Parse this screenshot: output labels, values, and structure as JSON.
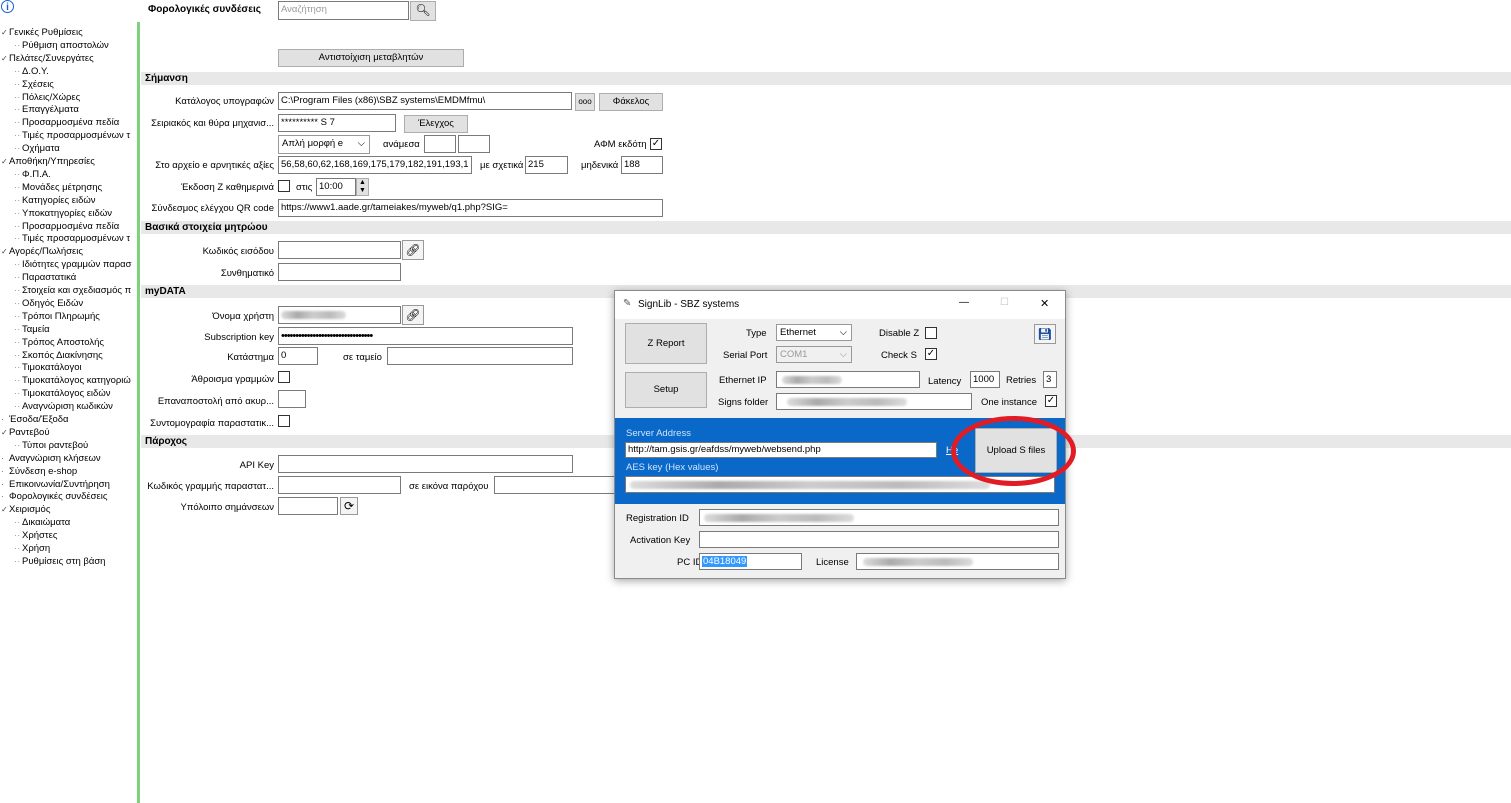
{
  "tree": {
    "items": [
      {
        "label": "Γενικές Ρυθμίσεις",
        "level": 0,
        "expanded": true
      },
      {
        "label": "Ρύθμιση αποστολών",
        "level": 1
      },
      {
        "label": "Πελάτες/Συνεργάτες",
        "level": 0,
        "expanded": true
      },
      {
        "label": "Δ.Ο.Υ.",
        "level": 1
      },
      {
        "label": "Σχέσεις",
        "level": 1
      },
      {
        "label": "Πόλεις/Χώρες",
        "level": 1
      },
      {
        "label": "Επαγγέλματα",
        "level": 1
      },
      {
        "label": "Προσαρμοσμένα πεδία",
        "level": 1
      },
      {
        "label": "Τιμές προσαρμοσμένων τ",
        "level": 1
      },
      {
        "label": "Οχήματα",
        "level": 1
      },
      {
        "label": "Αποθήκη/Υπηρεσίες",
        "level": 0,
        "expanded": true
      },
      {
        "label": "Φ.Π.Α.",
        "level": 1
      },
      {
        "label": "Μονάδες μέτρησης",
        "level": 1
      },
      {
        "label": "Κατηγορίες ειδών",
        "level": 1
      },
      {
        "label": "Υποκατηγορίες ειδών",
        "level": 1
      },
      {
        "label": "Προσαρμοσμένα πεδία",
        "level": 1
      },
      {
        "label": "Τιμές προσαρμοσμένων τ",
        "level": 1
      },
      {
        "label": "Αγορές/Πωλήσεις",
        "level": 0,
        "expanded": true
      },
      {
        "label": "Ιδιότητες γραμμών παρασ",
        "level": 1
      },
      {
        "label": "Παραστατικά",
        "level": 1
      },
      {
        "label": "Στοιχεία και σχεδιασμός π",
        "level": 1
      },
      {
        "label": "Οδηγός Ειδών",
        "level": 1
      },
      {
        "label": "Τρόποι Πληρωμής",
        "level": 1
      },
      {
        "label": "Ταμεία",
        "level": 1
      },
      {
        "label": "Τρόπος Αποστολής",
        "level": 1
      },
      {
        "label": "Σκοπός Διακίνησης",
        "level": 1
      },
      {
        "label": "Τιμοκατάλογοι",
        "level": 1
      },
      {
        "label": "Τιμοκατάλογος κατηγοριώ",
        "level": 1
      },
      {
        "label": "Τιμοκατάλογος ειδών",
        "level": 1
      },
      {
        "label": "Αναγνώριση κωδικών",
        "level": 1
      },
      {
        "label": "Έσοδα/Έξοδα",
        "level": 0
      },
      {
        "label": "Ραντεβού",
        "level": 0,
        "expanded": true
      },
      {
        "label": "Τύποι ραντεβού",
        "level": 1
      },
      {
        "label": "Αναγνώριση κλήσεων",
        "level": 0
      },
      {
        "label": "Σύνδεση e-shop",
        "level": 0
      },
      {
        "label": "Επικοινωνία/Συντήρηση",
        "level": 0
      },
      {
        "label": "Φορολογικές συνδέσεις",
        "level": 0
      },
      {
        "label": "Χειρισμός",
        "level": 0,
        "expanded": true
      },
      {
        "label": "Δικαιώματα",
        "level": 1
      },
      {
        "label": "Χρήστες",
        "level": 1
      },
      {
        "label": "Χρήση",
        "level": 1
      },
      {
        "label": "Ρυθμίσεις στη βάση",
        "level": 1
      }
    ]
  },
  "header": {
    "title": "Φορολογικές συνδέσεις",
    "search_placeholder": "Αναζήτηση",
    "map_vars_button": "Αντιστοίχιση μεταβλητών"
  },
  "sections": {
    "simansi": "Σήμανση",
    "mitroo": "Βασικά στοιχεία μητρώου",
    "mydata": "myDATA",
    "parochos": "Πάροχος"
  },
  "simansi": {
    "sig_dir_label": "Κατάλογος υπογραφών",
    "sig_dir_value": "C:\\Program Files (x86)\\SBZ systems\\EMDMfmu\\",
    "browse_btn": "ooo",
    "folder_btn": "Φάκελος",
    "serial_label": "Σειριακός και θύρα μηχανισ...",
    "serial_value": "********** S 7",
    "check_btn": "Έλεγχος",
    "format_value": "Απλή μορφή e",
    "between_label": "ανάμεσα",
    "afm_label": "ΑΦΜ εκδότη",
    "neg_label": "Στο αρχείο e αρνητικές αξίες",
    "neg_value": "56,58,60,62,168,169,175,179,182,191,193,1",
    "relative_label": "με σχετικά",
    "relative_value": "215",
    "zero_label": "μηδενικά",
    "zero_value": "188",
    "daily_z_label": "Έκδοση Ζ καθημερινά",
    "at_label": "στις",
    "time_value": "10:00",
    "qr_label": "Σύνδεσμος ελέγχου QR code",
    "qr_value": "https://www1.aade.gr/tameiakes/myweb/q1.php?SIG="
  },
  "mitroo": {
    "code_label": "Κωδικός εισόδου",
    "pass_label": "Συνθηματικό"
  },
  "mydata": {
    "user_label": "Όνομα χρήστη",
    "subkey_label": "Subscription key",
    "subkey_value": "••••••••••••••••••••••••••••••••",
    "store_label": "Κατάστημα",
    "store_value": "0",
    "till_label": "σε ταμείο",
    "sum_label": "Άθροισμα γραμμών",
    "resend_label": "Επαναποστολή από ακυρ...",
    "abbr_label": "Συντομογραφία παραστατικ..."
  },
  "parochos": {
    "api_label": "API Key",
    "line_code_label": "Κωδικός γραμμής παραστατ...",
    "image_label": "σε εικόνα παρόχου",
    "balance_label": "Υπόλοιπο σημάνσεων"
  },
  "dialog": {
    "title": "SignLib - SBZ systems",
    "minimize": "—",
    "maximize": "☐",
    "close": "✕",
    "z_report_btn": "Z Report",
    "setup_btn": "Setup",
    "type_label": "Type",
    "type_value": "Ethernet",
    "disable_z_label": "Disable Z",
    "serial_port_label": "Serial Port",
    "serial_port_value": "COM1",
    "check_s_label": "Check S",
    "ethernet_ip_label": "Ethernet IP",
    "latency_label": "Latency",
    "latency_value": "1000",
    "retries_label": "Retries",
    "retries_value": "3",
    "signs_folder_label": "Signs folder",
    "one_instance_label": "One instance",
    "server_address_label": "Server Address",
    "server_address_value": "http://tam.gsis.gr/eafdss/myweb/websend.php",
    "help_link": "He",
    "upload_btn": "Upload S files",
    "aes_label": "AES key (Hex values)",
    "registration_label": "Registration ID",
    "activation_label": "Activation Key",
    "pcid_label": "PC ID",
    "pcid_value": "04B18049",
    "license_label": "License"
  },
  "colors": {
    "tree_border": "#7fd07f",
    "dialog_blue": "#0a68c9",
    "highlight_circle": "#e21c24"
  }
}
